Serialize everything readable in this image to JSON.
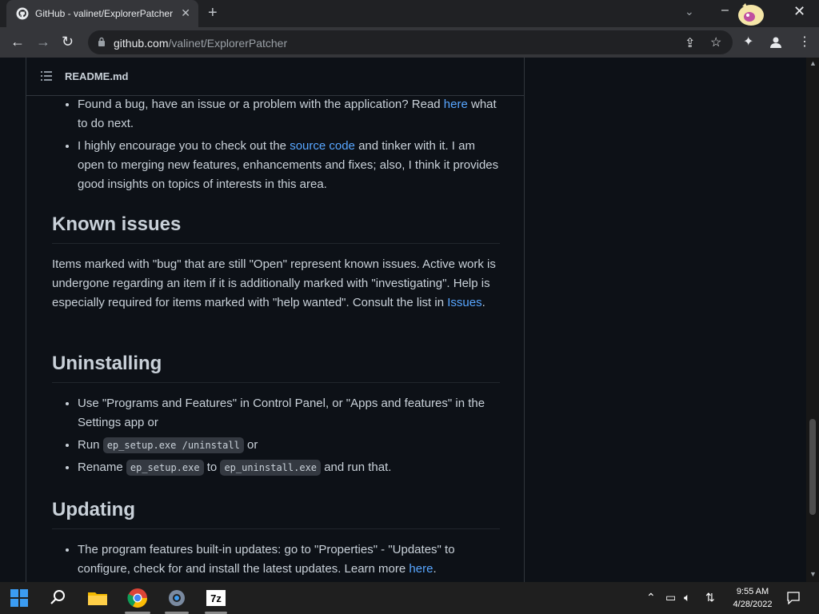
{
  "browser": {
    "tab_title": "GitHub - valinet/ExplorerPatcher",
    "url_host": "github.com",
    "url_path": "/valinet/ExplorerPatcher"
  },
  "readme": {
    "filename": "README.md",
    "bullets_top": [
      {
        "before": "Found a bug, have an issue or a problem with the application? Read ",
        "link": "here",
        "after": " what to do next."
      },
      {
        "before": "I highly encourage you to check out the ",
        "link": "source code",
        "after": " and tinker with it. I am open to merging new features, enhancements and fixes; also, I think it provides good insights on topics of interests in this area."
      }
    ],
    "known_issues": {
      "heading": "Known issues",
      "text": "Items marked with \"bug\" that are still \"Open\" represent known issues. Active work is undergone regarding an item if it is additionally marked with \"investigating\". Help is especially required for items marked with \"help wanted\". Consult the list in ",
      "link": "Issues",
      "after": "."
    },
    "uninstalling": {
      "heading": "Uninstalling",
      "item1": "Use \"Programs and Features\" in Control Panel, or \"Apps and features\" in the Settings app or",
      "item2_before": "Run ",
      "item2_code": "ep_setup.exe /uninstall",
      "item2_after": " or",
      "item3_before": "Rename ",
      "item3_code1": "ep_setup.exe",
      "item3_mid": " to ",
      "item3_code2": "ep_uninstall.exe",
      "item3_after": " and run that."
    },
    "updating": {
      "heading": "Updating",
      "text": "The program features built-in updates: go to \"Properties\" - \"Updates\" to configure, check for and install the latest updates. Learn more ",
      "link": "here",
      "after": "."
    }
  },
  "taskbar": {
    "time": "9:55 AM",
    "date": "4/28/2022"
  },
  "colors": {
    "link": "#58a6ff",
    "background": "#0d1117",
    "text": "#c9d1d9"
  },
  "icons": [
    "github-icon",
    "close-icon",
    "plus-icon",
    "chevron-down-icon",
    "back-icon",
    "forward-icon",
    "reload-icon",
    "lock-icon",
    "share-icon",
    "star-icon",
    "extensions-icon",
    "profile-icon",
    "more-icon",
    "list-icon",
    "windows-start-icon",
    "search-icon",
    "file-explorer-icon",
    "chrome-icon",
    "settings-icon",
    "7zip-icon",
    "chevron-up-icon",
    "network-icon",
    "volume-icon",
    "notification-icon"
  ]
}
